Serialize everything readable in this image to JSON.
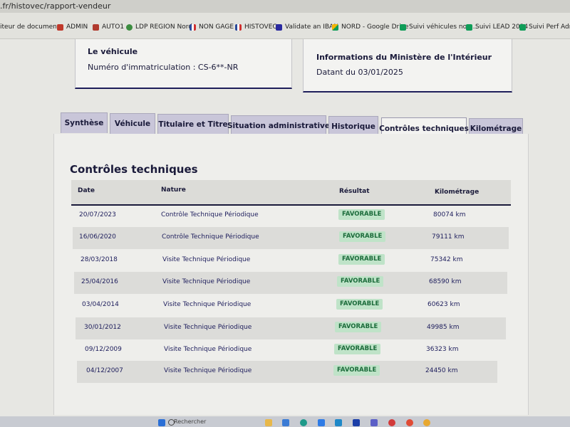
{
  "browser": {
    "address": ".fr/histovec/rapport-vendeur",
    "bookmarks": [
      {
        "label": "iteur de documen...",
        "color": "#6b7a8c"
      },
      {
        "label": "ADMIN",
        "color": "#c0392b"
      },
      {
        "label": "AUTO1",
        "color": "#b03a2e"
      },
      {
        "label": "LDP REGION Nord",
        "color": "#3c8d40"
      },
      {
        "label": "NON GAGE",
        "color": "#2a4a9a"
      },
      {
        "label": "HISTOVEC",
        "color": "#2a4a9a"
      },
      {
        "label": "Validate an IBAN",
        "color": "#2a2aa0"
      },
      {
        "label": "NORD - Google Drive",
        "color": "#f4b400"
      },
      {
        "label": "Suivi véhicules non...",
        "color": "#0f9d58"
      },
      {
        "label": "Suivi LEAD 2024",
        "color": "#0f9d58"
      },
      {
        "label": "Suivi Perf Admin -...",
        "color": "#0f9d58"
      }
    ]
  },
  "vehicle_card": {
    "title": "Le véhicule",
    "registration": "Numéro d'immatriculation : CS-6**-NR"
  },
  "ministry_card": {
    "title": "Informations du Ministère de l'Intérieur",
    "date": "Datant du 03/01/2025"
  },
  "tabs": [
    {
      "label": "Synthèse",
      "active": false
    },
    {
      "label": "Véhicule",
      "active": false
    },
    {
      "label": "Titulaire et Titre",
      "active": false
    },
    {
      "label": "Situation administrative",
      "active": false
    },
    {
      "label": "Historique",
      "active": false
    },
    {
      "label": "Contrôles techniques",
      "active": true
    },
    {
      "label": "Kilométrage",
      "active": false
    }
  ],
  "section": {
    "title": "Contrôles techniques",
    "headers": {
      "date": "Date",
      "nature": "Nature",
      "result": "Résultat",
      "mileage": "Kilométrage"
    },
    "rows": [
      {
        "date": "20/07/2023",
        "nature": "Contrôle Technique Périodique",
        "result": "FAVORABLE",
        "mileage": "80074 km"
      },
      {
        "date": "16/06/2020",
        "nature": "Contrôle Technique Périodique",
        "result": "FAVORABLE",
        "mileage": "79111 km"
      },
      {
        "date": "28/03/2018",
        "nature": "Visite Technique Périodique",
        "result": "FAVORABLE",
        "mileage": "75342 km"
      },
      {
        "date": "25/04/2016",
        "nature": "Visite Technique Périodique",
        "result": "FAVORABLE",
        "mileage": "68590 km"
      },
      {
        "date": "03/04/2014",
        "nature": "Visite Technique Périodique",
        "result": "FAVORABLE",
        "mileage": "60623 km"
      },
      {
        "date": "30/01/2012",
        "nature": "Visite Technique Périodique",
        "result": "FAVORABLE",
        "mileage": "49985 km"
      },
      {
        "date": "09/12/2009",
        "nature": "Visite Technique Périodique",
        "result": "FAVORABLE",
        "mileage": "36323 km"
      },
      {
        "date": "04/12/2007",
        "nature": "Visite Technique Périodique",
        "result": "FAVORABLE",
        "mileage": "24450 km"
      }
    ]
  },
  "taskbar": {
    "search_placeholder": "Rechercher",
    "icons": [
      "windows-icon",
      "search-icon",
      "files-icon",
      "store-icon",
      "edge-icon",
      "mail-icon",
      "l-app-icon",
      "teams-icon",
      "opera-icon",
      "chrome-icon",
      "chrome-alt-icon"
    ]
  },
  "colors": {
    "navy": "#1a1a3a",
    "tab_bg": "#c9c6d9",
    "badge_bg": "#bfe3c8",
    "badge_text": "#1b6b3a"
  }
}
